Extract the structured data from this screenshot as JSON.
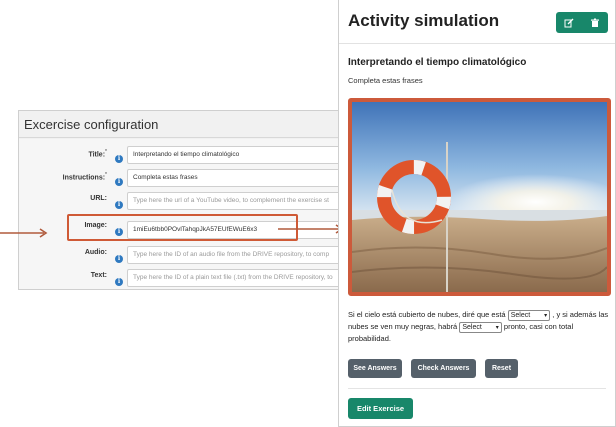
{
  "config": {
    "title": "Excercise configuration",
    "fields": [
      {
        "label": "Title:",
        "required": "*",
        "value": "Interpretando el tiempo climatológico",
        "placeholder": ""
      },
      {
        "label": "Instructions:",
        "required": "*",
        "value": "Completa estas frases",
        "placeholder": ""
      },
      {
        "label": "URL:",
        "required": "",
        "value": "",
        "placeholder": "Type here the url of a YouTube video, to complement the exercise st"
      },
      {
        "label": "Image:",
        "required": "",
        "value": "1miEu6tbb0POvlTahqpJkA57EUfEWuE6x3",
        "placeholder": ""
      },
      {
        "label": "Audio:",
        "required": "",
        "value": "",
        "placeholder": "Type here the ID of an audio file from the DRIVE repository, to comp"
      },
      {
        "label": "Text:",
        "required": "",
        "value": "",
        "placeholder": "Type here the ID of a plain text file (.txt) from the DRIVE repository, to"
      }
    ],
    "info_glyph": "i"
  },
  "activity": {
    "title": "Activity simulation",
    "header_icons": [
      "edit-icon",
      "trash-icon"
    ],
    "exercise_title": "Interpretando el tiempo climatológico",
    "instructions": "Completa estas frases",
    "image_desc": "photo-lifebuoy-on-beach",
    "sentence": {
      "part1": "Si el cielo está cubierto de nubes, diré que está",
      "select1": "Select",
      "part2": ", y si además las nubes se ven muy negras, habrá",
      "select2": "Select",
      "part3": "pronto, casi con total probabilidad."
    },
    "buttons": {
      "see_answers": "See Answers",
      "check_answers": "Check Answers",
      "reset": "Reset",
      "edit_exercise": "Edit Exercise"
    }
  },
  "colors": {
    "accent_green": "#18876a",
    "highlight_orange": "#cc5a3b",
    "button_grey": "#55606a",
    "info_blue": "#2f79c0"
  }
}
